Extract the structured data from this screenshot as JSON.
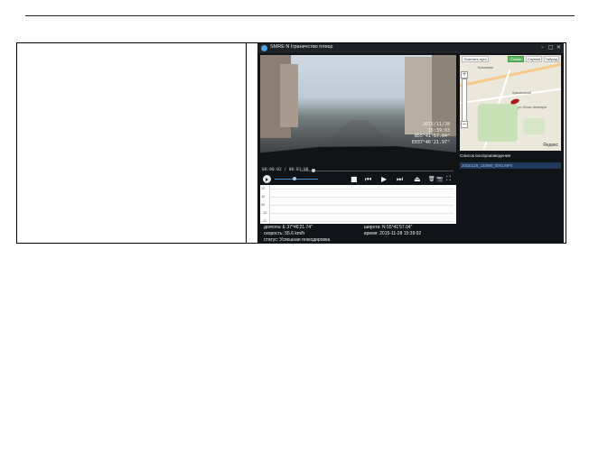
{
  "app": {
    "title": "SMRE N Іграничство плеєр",
    "window_buttons": {
      "minimize": "–",
      "maximize": "□",
      "close": "✕"
    }
  },
  "video": {
    "osd_date": "2015/11/28",
    "osd_time": "15:39:03",
    "osd_lat": "N55°41'57.04\"",
    "osd_lon": "E037°46'21.97\""
  },
  "timeline": {
    "time": "00:00:02 / 00:01:00",
    "position_fraction": 0.09
  },
  "volume": {
    "level_fraction": 0.45
  },
  "controls": {
    "stop": "■",
    "prev": "⏮",
    "play": "▶",
    "next": "⏭",
    "eject": "⏏",
    "delete": "🗑",
    "snapshot": "📷",
    "fullscreen": "⛶"
  },
  "graph": {
    "y_ticks": [
      "2G",
      "1G",
      "0G",
      "-1G",
      "-2G"
    ]
  },
  "info": {
    "longitude": "долгота: E 37°46'21.74\"",
    "latitude": "широта: N 55°41'57.04\"",
    "speed": "скорость: 55.6 km/h",
    "time": "время: 2015-11-28 15:39:02",
    "status": "статус: Успешная геокодировка"
  },
  "map": {
    "tabs": [
      "Очистить путь",
      "Схема",
      "Спутник",
      "Гибрид"
    ],
    "active_tab": 1,
    "labels": [
      "Кузьминки",
      "Кузьминский",
      "ул. Юных ленинцев"
    ],
    "brand": "Яндекс"
  },
  "playlist": {
    "header": "Список воспроизведения",
    "items": [
      "20151128_153900_0001.MP4"
    ]
  }
}
